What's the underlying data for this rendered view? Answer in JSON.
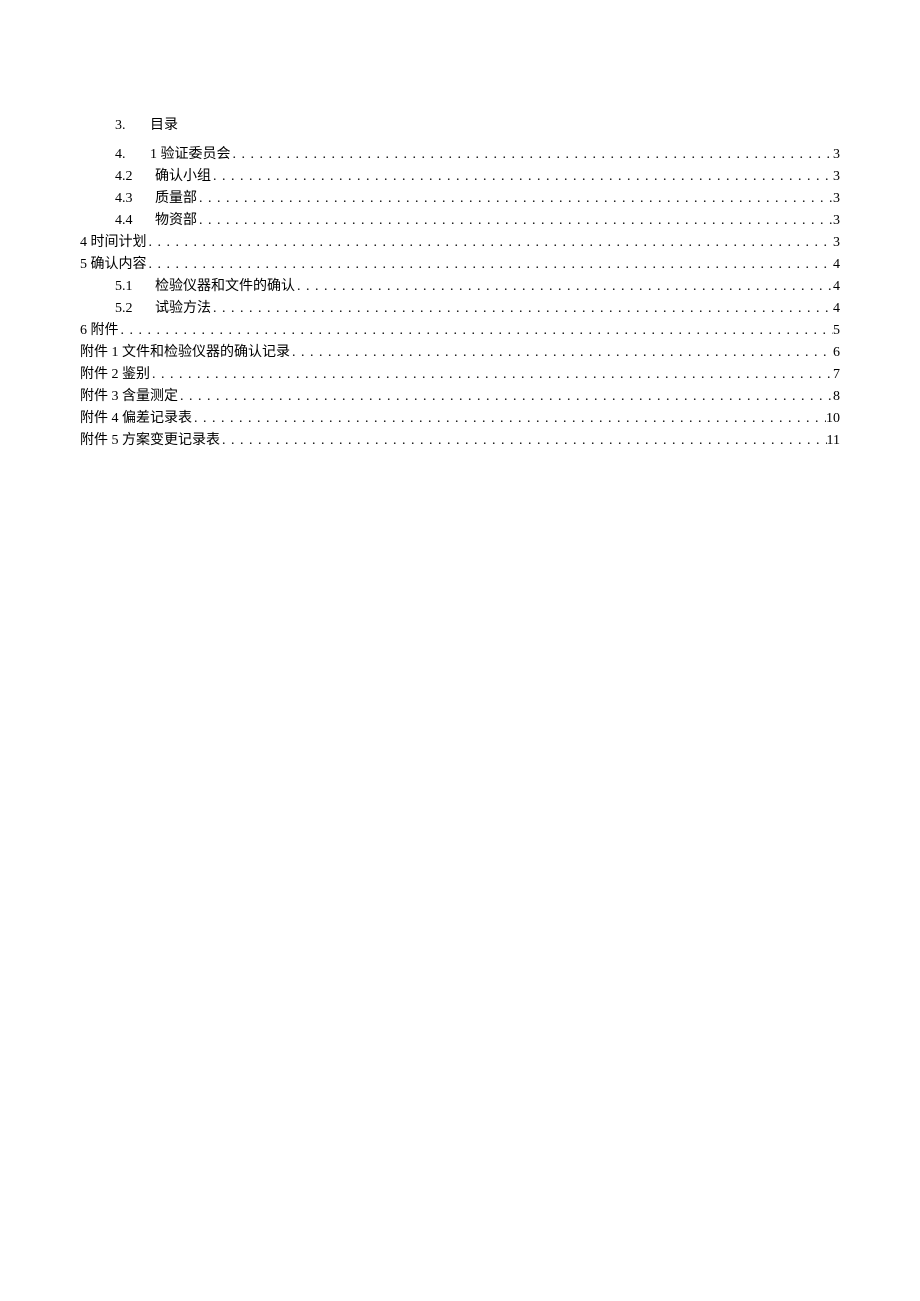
{
  "title": {
    "num": "3.",
    "text": "目录"
  },
  "entries": [
    {
      "indent": 1,
      "num": "4.",
      "label": "1 验证委员会",
      "page": "3"
    },
    {
      "indent": 1,
      "num": "4.2",
      "label": "确认小组",
      "page": "3"
    },
    {
      "indent": 1,
      "num": "4.3",
      "label": "质量部",
      "page": "3"
    },
    {
      "indent": 1,
      "num": "4.4",
      "label": "物资部",
      "page": "3"
    },
    {
      "indent": 0,
      "num": "",
      "label": "4 时间计划",
      "page": "3"
    },
    {
      "indent": 0,
      "num": "",
      "label": "5 确认内容",
      "page": "4"
    },
    {
      "indent": 1,
      "num": "5.1",
      "label": "检验仪器和文件的确认",
      "page": "4"
    },
    {
      "indent": 1,
      "num": "5.2",
      "label": "试验方法",
      "page": "4"
    },
    {
      "indent": 0,
      "num": "",
      "label": "6 附件",
      "page": "5"
    },
    {
      "indent": 0,
      "num": "",
      "label": "附件 1 文件和检验仪器的确认记录",
      "page": "6"
    },
    {
      "indent": 0,
      "num": "",
      "label": "附件 2 鉴别",
      "page": "7"
    },
    {
      "indent": 0,
      "num": "",
      "label": "附件 3 含量测定",
      "page": "8"
    },
    {
      "indent": 0,
      "num": "",
      "label": "附件 4 偏差记录表",
      "page": "10"
    },
    {
      "indent": 0,
      "num": "",
      "label": "附件 5 方案变更记录表",
      "page": "11"
    }
  ]
}
